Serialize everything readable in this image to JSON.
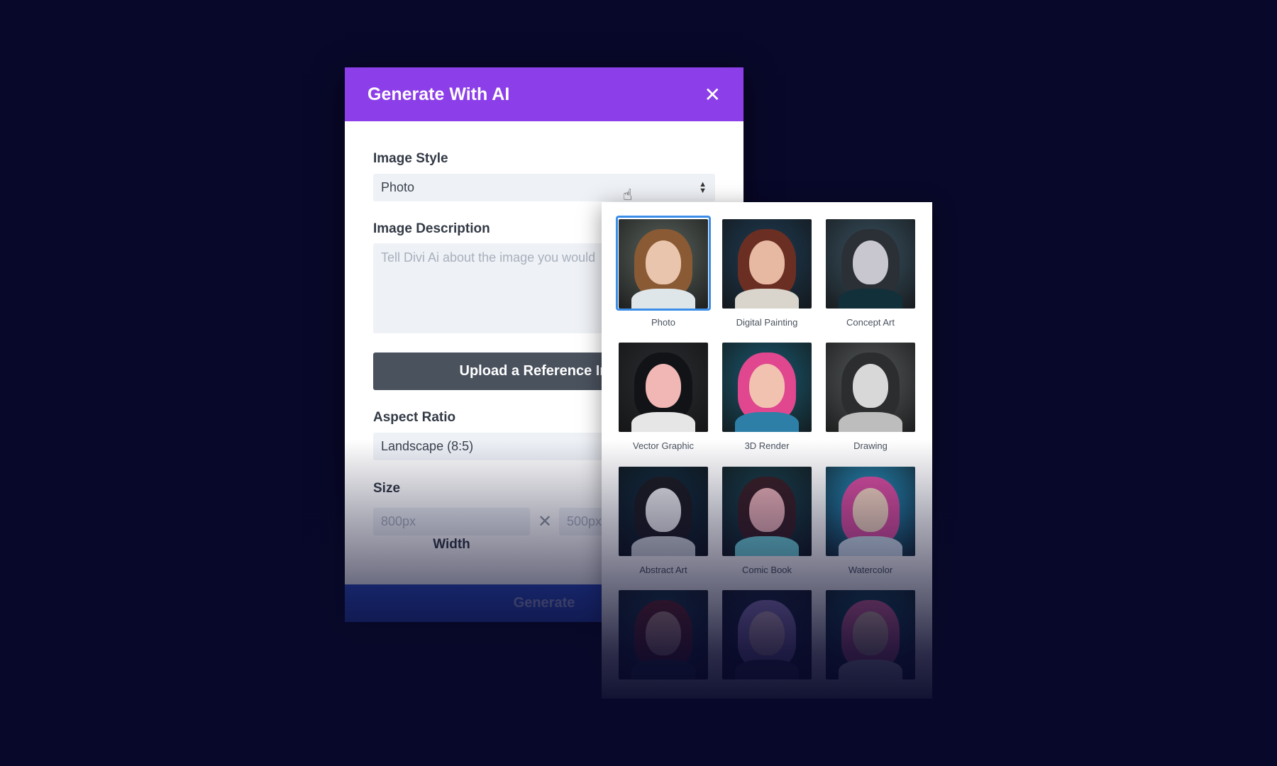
{
  "modal": {
    "title": "Generate With AI",
    "close_icon": "close-icon",
    "image_style_label": "Image Style",
    "image_style_value": "Photo",
    "image_description_label": "Image Description",
    "image_description_placeholder": "Tell Divi Ai about the image you would",
    "upload_label": "Upload a Reference Imag",
    "aspect_ratio_label": "Aspect Ratio",
    "aspect_ratio_value": "Landscape (8:5)",
    "size_label": "Size",
    "width_placeholder": "800px",
    "height_placeholder": "500px",
    "width_caption": "Width",
    "generate_label": "Generate"
  },
  "style_picker": {
    "selected": "Photo",
    "items": [
      {
        "label": "Photo",
        "colors": [
          "#5d6660",
          "#8a5a34",
          "#e9c5ad",
          "#dfe6ea"
        ]
      },
      {
        "label": "Digital Painting",
        "colors": [
          "#1f3d56",
          "#6b2e22",
          "#e7b9a2",
          "#d9d4cc"
        ]
      },
      {
        "label": "Concept Art",
        "colors": [
          "#3a5363",
          "#2b2f36",
          "#c8c6cf",
          "#12303a"
        ]
      },
      {
        "label": "Vector Graphic",
        "colors": [
          "#2b2d31",
          "#121316",
          "#f0b7b4",
          "#e6e6e6"
        ]
      },
      {
        "label": "3D Render",
        "colors": [
          "#1a5b72",
          "#e0478f",
          "#f2c2b1",
          "#2e7fa8"
        ]
      },
      {
        "label": "Drawing",
        "colors": [
          "#565a5c",
          "#2c2d2f",
          "#d8d8d8",
          "#bdbdbd"
        ]
      },
      {
        "label": "Abstract Art",
        "colors": [
          "#123245",
          "#1d1d22",
          "#e9e9ec",
          "#cfd5d8"
        ]
      },
      {
        "label": "Comic Book",
        "colors": [
          "#1a4a55",
          "#3a2025",
          "#eab1b6",
          "#6fd1d8"
        ]
      },
      {
        "label": "Watercolor",
        "colors": [
          "#2aa5d8",
          "#d94fa0",
          "#f4d3c0",
          "#cfe0ec"
        ]
      },
      {
        "label": "",
        "colors": [
          "#1f4d5c",
          "#6b2a2a",
          "#d8a898",
          "#26404a"
        ]
      },
      {
        "label": "",
        "colors": [
          "#1d3550",
          "#9a86c9",
          "#e3c6d3",
          "#3a3c58"
        ]
      },
      {
        "label": "",
        "colors": [
          "#1a6470",
          "#e06ba0",
          "#f1c7b6",
          "#e3e8ec"
        ]
      }
    ]
  },
  "colors": {
    "background": "#08082a",
    "header": "#8c3fe8",
    "generate": "#2b4fc4",
    "upload": "#4a525e",
    "selected_border": "#3b8ee8"
  }
}
